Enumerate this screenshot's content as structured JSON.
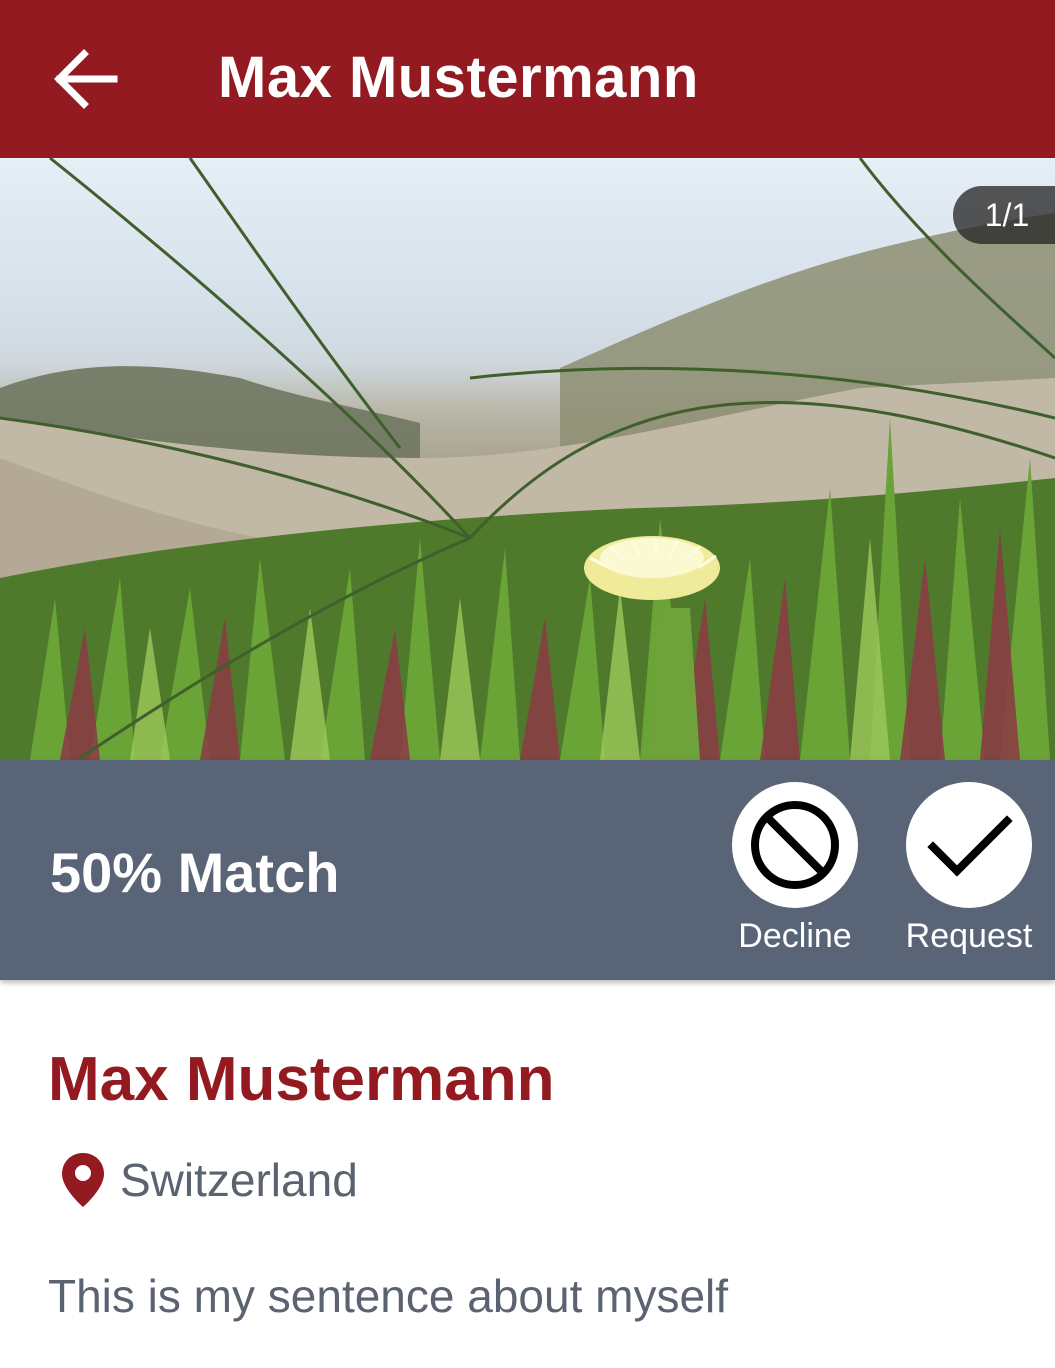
{
  "app_bar": {
    "title": "Max Mustermann",
    "back_icon": "arrow-left-icon",
    "background_color": "#941a21"
  },
  "photo": {
    "counter": "1/1"
  },
  "match": {
    "text": "50% Match",
    "background_color": "#596577",
    "decline": {
      "label": "Decline",
      "icon": "block-icon"
    },
    "request": {
      "label": "Request",
      "icon": "check-icon"
    }
  },
  "profile": {
    "name": "Max Mustermann",
    "location": "Switzerland",
    "location_icon": "location-pin-icon",
    "about": "This is my sentence about myself",
    "accent_color": "#941a21",
    "text_color": "#5b6371"
  }
}
